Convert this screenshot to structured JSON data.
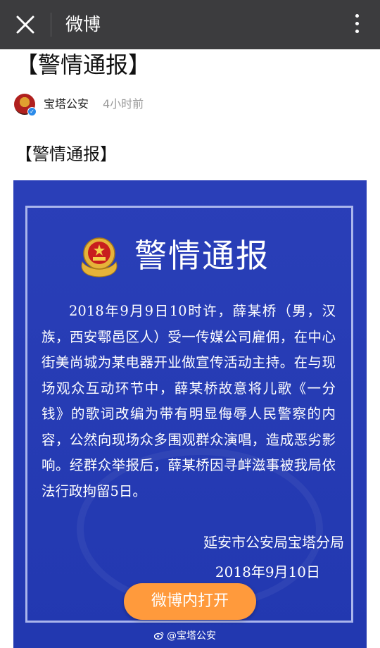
{
  "header": {
    "app_title": "微博",
    "close_icon": "close-icon",
    "more_icon": "more-vertical-icon"
  },
  "post": {
    "title": "【警情通报】",
    "author": "宝塔公安",
    "timestamp": "4小时前",
    "body_text": "【警情通报】"
  },
  "poster": {
    "title": "警情通报",
    "paragraph": "2018年9月9日10时许，薛某桥（男，汉族，西安鄠邑区人）受一传媒公司雇佣，在中心街美尚城为某电器开业做宣传活动主持。在与现场观众互动环节中，薛某桥故意将儿歌《一分钱》的歌词改编为带有明显侮辱人民警察的内容，公然向现场众多围观群众演唱，造成恶劣影响。经群众举报后，薛某桥因寻衅滋事被我局依法行政拘留5日。",
    "signature": "延安市公安局宝塔分局",
    "date": "2018年9月10日",
    "watermark": "@宝塔公安",
    "background_color": "#2a3fb8"
  },
  "actions": {
    "open_in_app": "微博内打开",
    "accent": "#ff9a3c"
  }
}
